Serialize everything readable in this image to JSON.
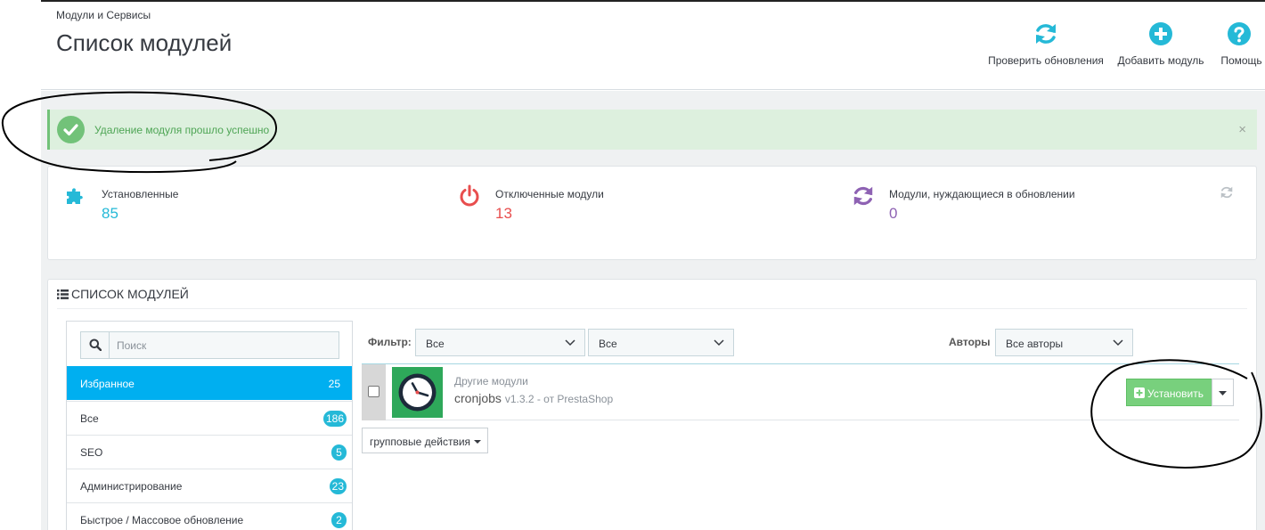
{
  "header": {
    "breadcrumb": "Модули и Сервисы",
    "title": "Список модулей",
    "toolbar": {
      "check_updates": "Проверить обновления",
      "add_module": "Добавить модуль",
      "help": "Помощь"
    }
  },
  "alert": {
    "text": "Удаление модуля прошло успешно",
    "close": "×"
  },
  "stats": {
    "installed": {
      "label": "Установленные",
      "value": "85"
    },
    "disabled": {
      "label": "Отключенные модули",
      "value": "13"
    },
    "updates": {
      "label": "Модули, нуждающиеся в обновлении",
      "value": "0"
    }
  },
  "modules_panel": {
    "heading": "СПИСОК МОДУЛЕЙ",
    "search": {
      "placeholder": "Поиск",
      "value": ""
    },
    "categories": [
      {
        "label": "Избранное",
        "count": "25"
      },
      {
        "label": "Все",
        "count": "186"
      },
      {
        "label": "SEO",
        "count": "5"
      },
      {
        "label": "Администрирование",
        "count": "23"
      },
      {
        "label": "Быстрое / Массовое обновление",
        "count": "2"
      }
    ],
    "filters": {
      "filter_label": "Фильтр:",
      "filter_1": "Все",
      "filter_2": "Все",
      "authors_label": "Авторы",
      "authors": "Все авторы"
    },
    "module": {
      "category": "Другие модули",
      "name": "cronjobs",
      "version": "v1.3.2 - от PrestaShop",
      "install_label": "Установить"
    },
    "bulk_actions": "групповые действия"
  },
  "colors": {
    "accent": "#25b9d7",
    "active_category": "#00aff0",
    "success": "#72c279",
    "danger": "#e84e4e",
    "purple": "#8e62b3"
  }
}
